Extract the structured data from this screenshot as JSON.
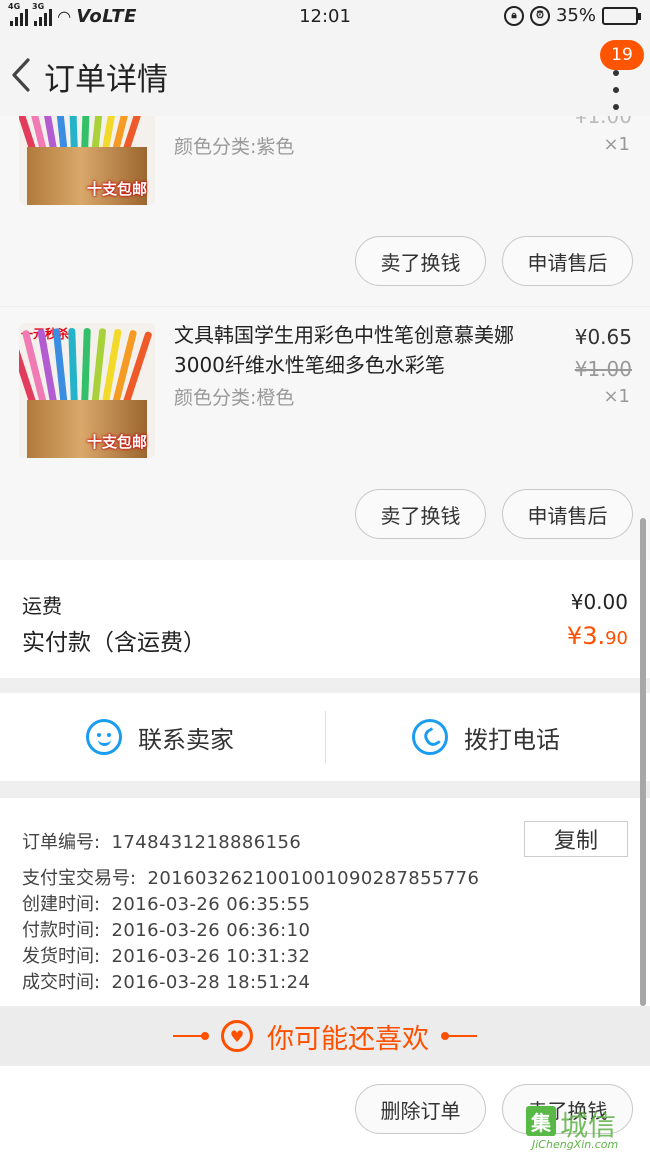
{
  "status_bar": {
    "sim1": "4G",
    "sim2": "3G",
    "network": "VoLTE",
    "time": "12:01",
    "battery": "35%",
    "battery_level": 0.35
  },
  "nav": {
    "title": "订单详情",
    "badge": "19"
  },
  "items": [
    {
      "spec": "颜色分类:紫色",
      "price_partial": "¥1.00",
      "qty": "×1",
      "promo": "十支包邮",
      "actions": [
        "卖了换钱",
        "申请售后"
      ]
    },
    {
      "tag": "一元秒杀",
      "title": "文具韩国学生用彩色中性笔创意慕美娜3000纤维水性笔细多色水彩笔",
      "price": "¥0.65",
      "original_price": "¥1.00",
      "spec": "颜色分类:橙色",
      "qty": "×1",
      "promo": "十支包邮",
      "actions": [
        "卖了换钱",
        "申请售后"
      ]
    }
  ],
  "totals": {
    "shipping_label": "运费",
    "shipping_value": "¥0.00",
    "paid_label": "实付款（含运费）",
    "paid_main": "¥3.",
    "paid_cents": "90"
  },
  "contact": {
    "seller": "联系卖家",
    "call": "拨打电话"
  },
  "order_info": {
    "copy_button": "复制",
    "rows": [
      {
        "label": "订单编号:",
        "value": "1748431218886156"
      },
      {
        "label": "支付宝交易号:",
        "value": "2016032621001001090287855776"
      },
      {
        "label": "创建时间:",
        "value": "2016-03-26 06:35:55"
      },
      {
        "label": "付款时间:",
        "value": "2016-03-26 06:36:10"
      },
      {
        "label": "发货时间:",
        "value": "2016-03-26 10:31:32"
      },
      {
        "label": "成交时间:",
        "value": "2016-03-28 18:51:24"
      }
    ]
  },
  "recommend": {
    "label": "你可能还喜欢"
  },
  "bottom": {
    "delete": "删除订单",
    "sell": "卖了换钱"
  },
  "watermark": {
    "box": "集",
    "text": "城信",
    "url": "JiChengXin.com"
  },
  "colors": {
    "accent": "#ff5000",
    "badge": "#ff5500",
    "link_blue": "#1a9cf0"
  }
}
